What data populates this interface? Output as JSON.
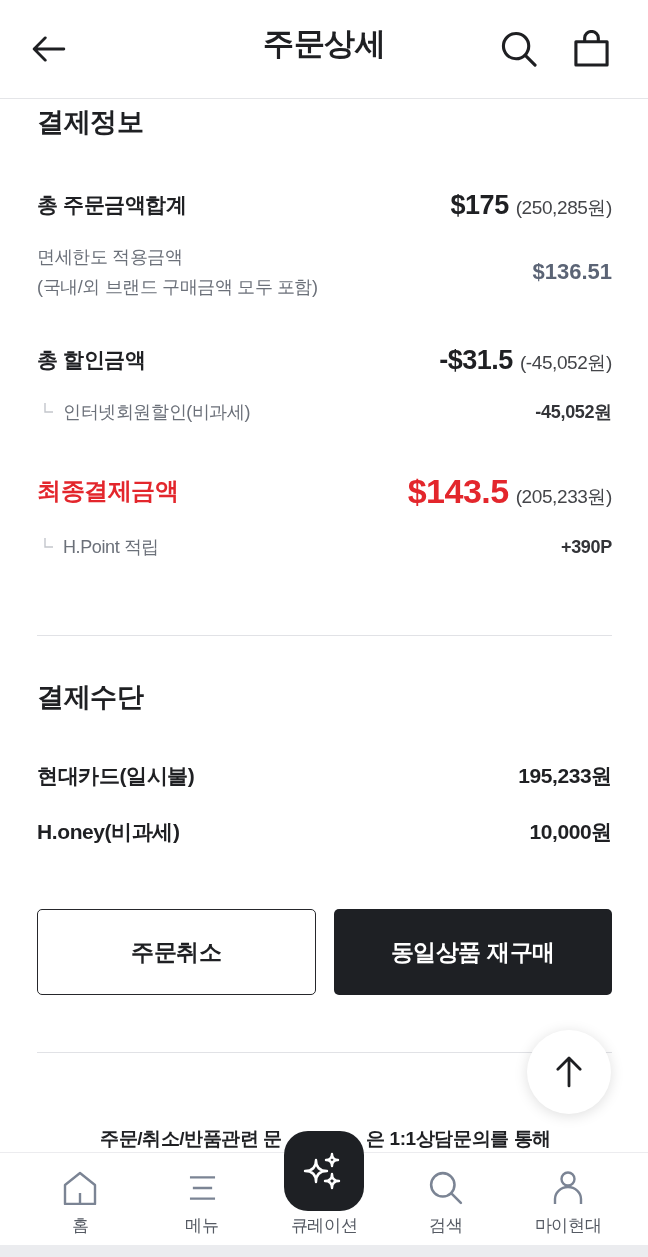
{
  "header": {
    "title": "주문상세"
  },
  "payment_info": {
    "heading": "결제정보",
    "rows": [
      {
        "kind": "total",
        "label": "총 주문금액합계",
        "amount": "$175",
        "krw": "(250,285원)"
      },
      {
        "kind": "note",
        "lines": [
          "면세한도 적용금액",
          "(국내/외 브랜드 구매금액 모두 포함)"
        ],
        "amount": "$136.51"
      },
      {
        "kind": "total",
        "label": "총 할인금액",
        "amount": "-$31.5",
        "krw": "(-45,052원)"
      },
      {
        "kind": "sub",
        "label": "인터넷회원할인(비과세)",
        "amount": "-45,052원"
      },
      {
        "kind": "final",
        "label": "최종결제금액",
        "amount": "$143.5",
        "krw": "(205,233원)"
      },
      {
        "kind": "sub",
        "label": "H.Point 적립",
        "amount": "+390P"
      }
    ]
  },
  "payment_method": {
    "heading": "결제수단",
    "rows": [
      {
        "label": "현대카드(일시불)",
        "amount": "195,233원"
      },
      {
        "label": "H.oney(비과세)",
        "amount": "10,000원"
      }
    ]
  },
  "buttons": [
    {
      "kind": "outline",
      "label": "주문취소"
    },
    {
      "kind": "filled",
      "label": "동일상품 재구매"
    }
  ],
  "notice": {
    "parts": [
      "주문/취소/반품관련 문",
      "은 1:1상담문의를 통해"
    ]
  },
  "bottom_nav": [
    {
      "kind": "home",
      "label": "홈"
    },
    {
      "kind": "menu",
      "label": "메뉴"
    },
    {
      "kind": "curation",
      "label": "큐레이션"
    },
    {
      "kind": "search",
      "label": "검색"
    },
    {
      "kind": "profile",
      "label": "마이현대"
    }
  ]
}
